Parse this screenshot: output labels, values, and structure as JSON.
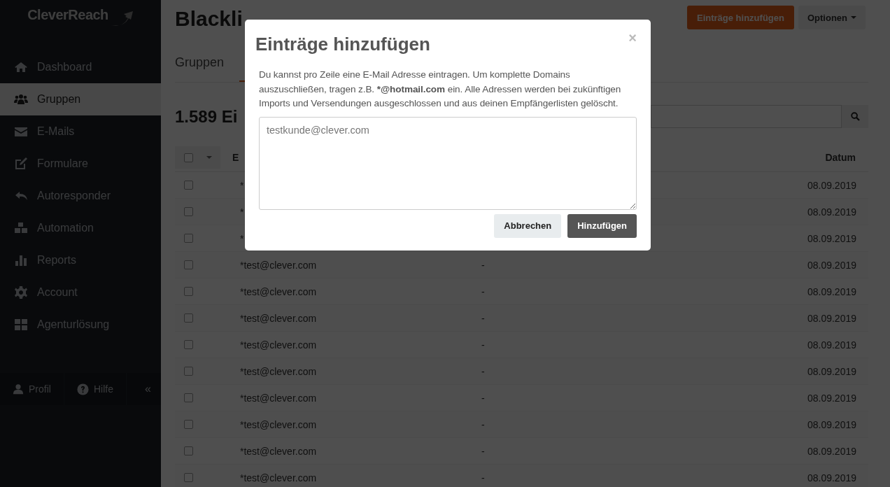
{
  "sidebar": {
    "logo": "CleverReach",
    "items": [
      {
        "label": "Dashboard",
        "selected": false
      },
      {
        "label": "Gruppen",
        "selected": true
      },
      {
        "label": "E-Mails",
        "selected": false
      },
      {
        "label": "Formulare",
        "selected": false
      },
      {
        "label": "Autoresponder",
        "selected": false
      },
      {
        "label": "Automation",
        "selected": false
      },
      {
        "label": "Reports",
        "selected": false
      },
      {
        "label": "Account",
        "selected": false
      },
      {
        "label": "Agenturlösung",
        "selected": false
      }
    ],
    "footer": {
      "profile": "Profil",
      "help": "Hilfe",
      "collapse": "«"
    }
  },
  "page": {
    "title": "Blackli",
    "actions": {
      "add": "Einträge hinzufügen",
      "options": "Optionen"
    },
    "tabs": [
      {
        "label": "Gruppen",
        "selected": false
      },
      {
        "selected": true
      }
    ],
    "count_title": "1.589 Ei",
    "table": {
      "columns": [
        "E",
        "Datum"
      ],
      "select_all_checked": false,
      "rows": [
        {
          "email": "*",
          "date": "08.09.2019",
          "checked": false
        },
        {
          "email": "*",
          "date": "08.09.2019",
          "checked": false
        },
        {
          "email": "*",
          "date": "08.09.2019",
          "checked": false
        },
        {
          "email": "*test@clever.com",
          "note": "-",
          "date": "08.09.2019",
          "checked": false
        },
        {
          "email": "*test@clever.com",
          "note": "-",
          "date": "08.09.2019",
          "checked": false
        },
        {
          "email": "*test@clever.com",
          "note": "-",
          "date": "08.09.2019",
          "checked": false
        },
        {
          "email": "*test@clever.com",
          "note": "-",
          "date": "08.09.2019",
          "checked": false
        },
        {
          "email": "*test@clever.com",
          "note": "-",
          "date": "08.09.2019",
          "checked": false
        },
        {
          "email": "*test@clever.com",
          "note": "-",
          "date": "08.09.2019",
          "checked": false
        },
        {
          "email": "*test@clever.com",
          "note": "-",
          "date": "08.09.2019",
          "checked": false
        },
        {
          "email": "*test@clever.com",
          "note": "-",
          "date": "08.09.2019",
          "checked": false
        },
        {
          "email": "*test@clever.com",
          "note": "-",
          "date": "08.09.2019",
          "checked": false
        }
      ]
    }
  },
  "dialog": {
    "title": "Einträge hinzufügen",
    "close": "×",
    "text": "Du kannst pro Zeile eine E-Mail Adresse eintragen. Um komplette Domains auszuschließen, tragen z.B. ***@hotmail.com** ein. Alle Adressen werden bei zukünftigen Imports und Versendungen ausgeschlossen und aus deinen Empfängerlisten gelöscht.",
    "placeholder": "testkunde@clever.com",
    "cancel": "Abbrechen",
    "confirm": "Hinzufügen"
  }
}
